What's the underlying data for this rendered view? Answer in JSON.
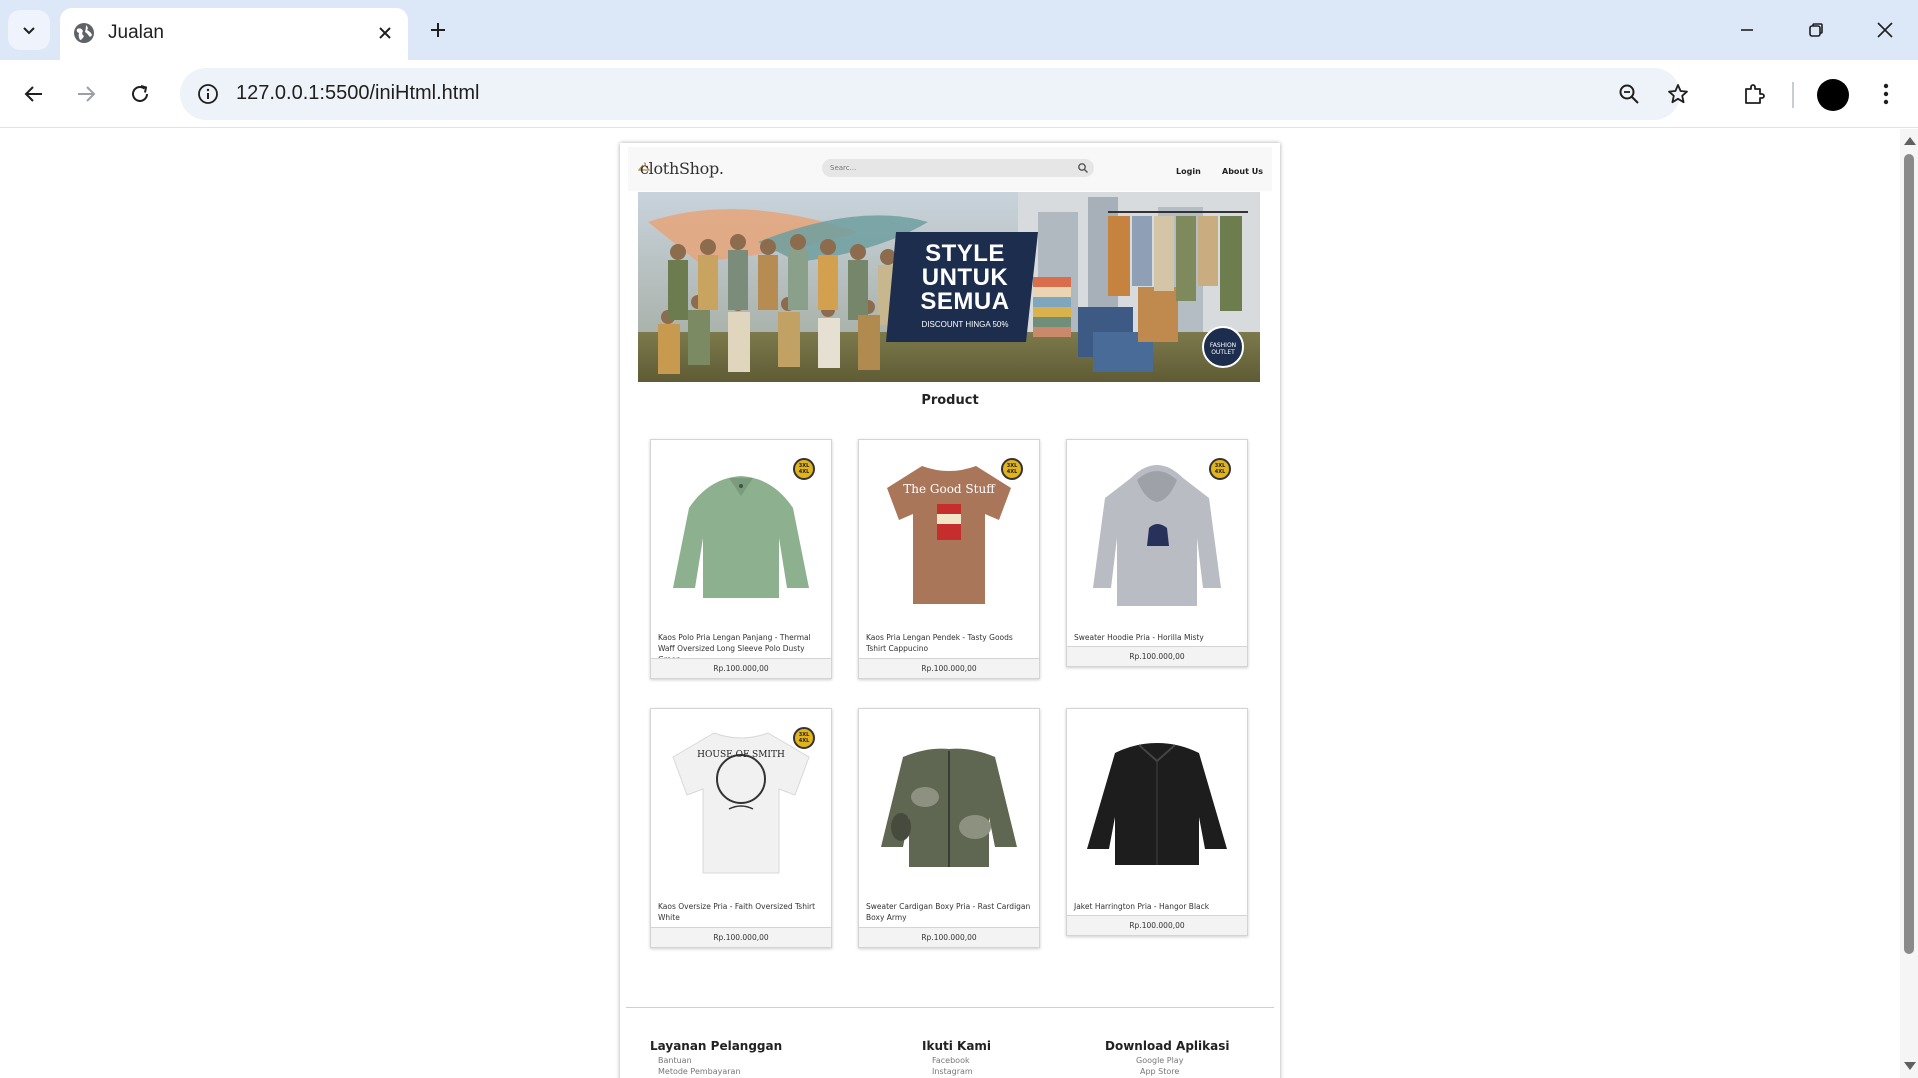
{
  "browser": {
    "tab_title": "Jualan",
    "url": "127.0.0.1:5500/iniHtml.html"
  },
  "site": {
    "logo": "clothShop.",
    "search_placeholder": "Searc...",
    "nav": {
      "login": "Login",
      "about": "About Us"
    },
    "banner": {
      "headline_1": "STYLE",
      "headline_2": "UNTUK",
      "headline_3": "SEMUA",
      "sub": "DISCOUNT HINGA 50%",
      "badge": "FASHION OUTLET"
    },
    "section_title": "Product",
    "products": [
      {
        "name": "Kaos Polo Pria Lengan Panjang - Thermal Waff Oversized Long Sleeve Polo Dusty Green",
        "price": "Rp.100.000,00",
        "badge": "3XL 4XL",
        "color": "#8db08f"
      },
      {
        "name": "Kaos Pria Lengan Pendek - Tasty Goods Tshirt Cappucino",
        "price": "Rp.100.000,00",
        "badge": "3XL 4XL",
        "color": "#a9765a",
        "print": "The Good Stuff"
      },
      {
        "name": "Sweater Hoodie Pria - Horilla Misty",
        "price": "Rp.100.000,00",
        "badge": "3XL 4XL",
        "color": "#b9bcc2"
      },
      {
        "name": "Kaos Oversize Pria - Faith Oversized Tshirt White",
        "price": "Rp.100.000,00",
        "badge": "3XL 4XL",
        "color": "#f1f1f1",
        "print": "HOUSE OF SMITH"
      },
      {
        "name": "Sweater Cardigan Boxy Pria - Rast Cardigan Boxy Army",
        "price": "Rp.100.000,00",
        "color": "#5f6652"
      },
      {
        "name": "Jaket Harrington Pria - Hangor Black",
        "price": "Rp.100.000,00",
        "color": "#1d1d1d"
      }
    ],
    "footer": {
      "col1_title": "Layanan Pelanggan",
      "col1_items": [
        "Bantuan",
        "Metode Pembayaran"
      ],
      "col2_title": "Ikuti Kami",
      "col2_items": [
        "Facebook",
        "Instagram"
      ],
      "col3_title": "Download Aplikasi",
      "col3_items": [
        "Google Play",
        "App Store"
      ]
    }
  }
}
